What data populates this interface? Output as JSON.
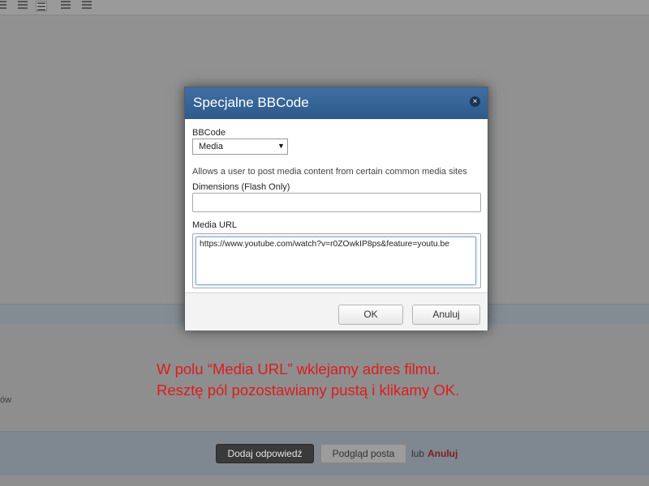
{
  "dialog": {
    "title": "Specjalne BBCode",
    "close_glyph": "×",
    "bbcode_label": "BBCode",
    "bbcode_selected": "Media",
    "bbcode_arrow": "▼",
    "description": "Allows a user to post media content from certain common media sites",
    "dimensions_label": "Dimensions (Flash Only)",
    "dimensions_value": "",
    "media_url_label": "Media URL",
    "media_url_value": "https://www.youtube.com/watch?v=r0ZOwkIP8ps&feature=youtu.be",
    "ok_label": "OK",
    "cancel_label": "Anuluj"
  },
  "caption": {
    "line1": "W polu “Media URL” wklejamy adres filmu.",
    "line2": "Resztę pól pozostawiamy pustą i klikamy OK.",
    "color": "#e01b1b"
  },
  "background": {
    "options_fragment": "ów",
    "submit_label": "Dodaj odpowiedź",
    "preview_label": "Podgląd posta",
    "or_text": "lub",
    "cancel_link": "Anuluj"
  },
  "colors": {
    "dialog_header": "#3a679b",
    "overlay_tint": "#8f8f8f"
  }
}
